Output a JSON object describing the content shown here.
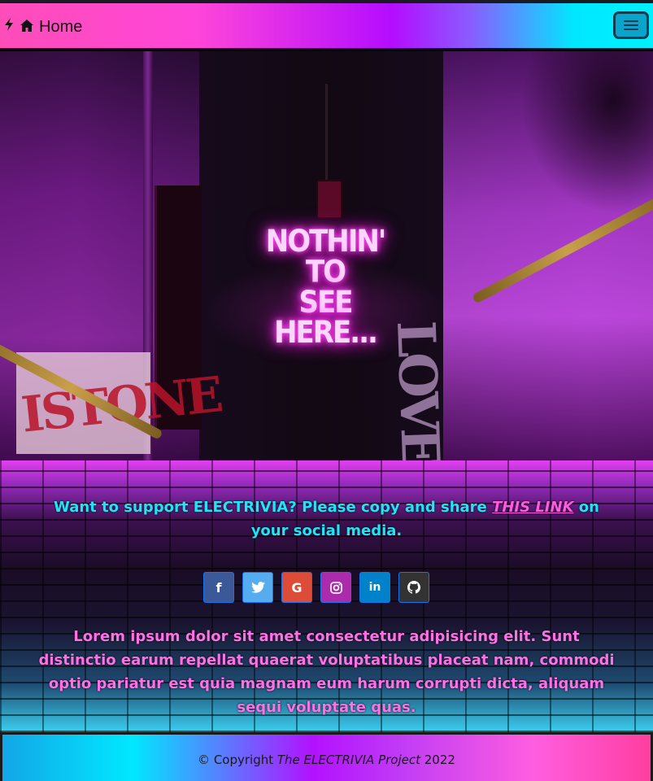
{
  "navbar": {
    "brand_label": "Home",
    "bolt_icon": "lightning-icon",
    "house_icon": "house-icon",
    "toggler_icon": "hamburger-menu-icon"
  },
  "hero": {
    "neon_line1": "NOTHIN' TO",
    "neon_line2": "SEE HERE...",
    "poster_text": "ISTONE",
    "graffiti_text": "LOVE"
  },
  "support": {
    "text_before": "Want to support ELECTRIVIA? Please copy and share",
    "link_label": "THIS LINK",
    "text_after": "on your social media."
  },
  "socials": [
    {
      "name": "facebook",
      "glyph": "f",
      "color": "#3b5998"
    },
    {
      "name": "twitter",
      "glyph": "",
      "color": "#55acee"
    },
    {
      "name": "google",
      "glyph": "G",
      "color": "#dd4b39"
    },
    {
      "name": "instagram",
      "glyph": "",
      "color": "#ac2bac"
    },
    {
      "name": "linkedin",
      "glyph": "in",
      "color": "#0082ca"
    },
    {
      "name": "github",
      "glyph": "",
      "color": "#333333"
    }
  ],
  "lorem": "Lorem ipsum dolor sit amet consectetur adipisicing elit. Sunt distinctio earum repellat quaerat voluptatibus placeat nam, commodi optio pariatur est quia magnam eum harum corrupti dicta, aliquam sequi voluptate quas.",
  "footer": {
    "copyright_prefix": "© Copyright",
    "project_name": "The ELECTRIVIA Project",
    "year": "2022"
  },
  "colors": {
    "accent_cyan": "#1fe6f7",
    "accent_pink": "#ff70e6",
    "link_pink": "#ff5be0"
  }
}
